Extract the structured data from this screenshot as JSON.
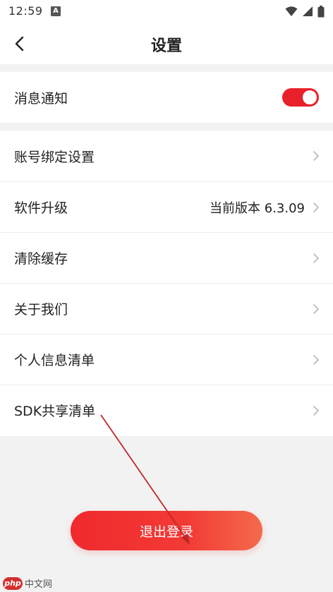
{
  "status_bar": {
    "time": "12:59",
    "notification_badge": "A"
  },
  "header": {
    "title": "设置"
  },
  "notify": {
    "label": "消息通知",
    "enabled": true
  },
  "settings_list": [
    {
      "label": "账号绑定设置"
    },
    {
      "label": "软件升级",
      "value": "当前版本 6.3.09"
    },
    {
      "label": "清除缓存"
    },
    {
      "label": "关于我们"
    },
    {
      "label": "个人信息清单"
    },
    {
      "label": "SDK共享清单"
    }
  ],
  "logout": {
    "label": "退出登录"
  },
  "watermark": {
    "logo": "php",
    "text": "中文网"
  },
  "colors": {
    "accent": "#e8202a",
    "background": "#f2f2f2",
    "annotation": "#c0262b"
  }
}
